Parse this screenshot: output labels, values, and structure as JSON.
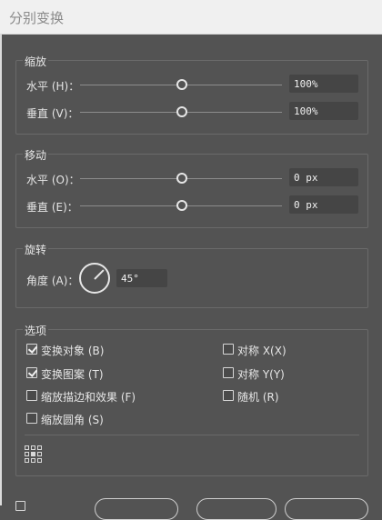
{
  "window": {
    "title": "分别变换"
  },
  "scale": {
    "legend": "缩放",
    "horizontal": {
      "label": "水平 (H)：",
      "value": "100%",
      "slider_fraction": 0.5
    },
    "vertical": {
      "label": "垂直 (V)：",
      "value": "100%",
      "slider_fraction": 0.5
    }
  },
  "move": {
    "legend": "移动",
    "horizontal": {
      "label": "水平 (O)：",
      "value": "0 px",
      "slider_fraction": 0.5
    },
    "vertical": {
      "label": "垂直 (E)：",
      "value": "0 px",
      "slider_fraction": 0.5
    }
  },
  "rotate": {
    "legend": "旋转",
    "angle_label": "角度 (A)：",
    "angle_value": "45°",
    "angle_degrees": 45
  },
  "options": {
    "legend": "选项",
    "transform_objects": {
      "label": "变换对象 (B)",
      "checked": true
    },
    "transform_patterns": {
      "label": "变换图案 (T)",
      "checked": true
    },
    "scale_strokes": {
      "label": "缩放描边和效果 (F)",
      "checked": false
    },
    "scale_corners": {
      "label": "缩放圆角 (S)",
      "checked": false
    },
    "reflect_x": {
      "label": "对称 X(X)",
      "checked": false
    },
    "reflect_y": {
      "label": "对称 Y(Y)",
      "checked": false
    },
    "random": {
      "label": "随机 (R)",
      "checked": false
    },
    "reference_point_icon": "reference-point-grid-icon"
  },
  "colors": {
    "dialog_bg": "#535353",
    "field_bg": "#454545",
    "text": "#e6e6e6",
    "titlebar_bg": "#f0f0f0"
  }
}
